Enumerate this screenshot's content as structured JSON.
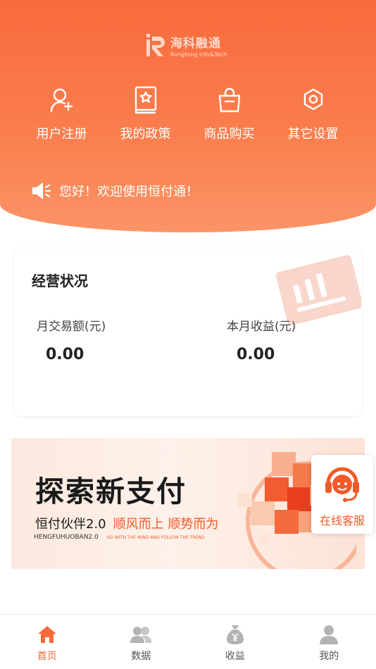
{
  "brand": {
    "name": "海科融通",
    "sub": "Rongtong Info&Tech"
  },
  "quick_actions": [
    {
      "label": "用户注册",
      "icon": "user-add-icon"
    },
    {
      "label": "我的政策",
      "icon": "policy-book-icon"
    },
    {
      "label": "商品购买",
      "icon": "shopping-bag-icon"
    },
    {
      "label": "其它设置",
      "icon": "settings-hex-icon"
    }
  ],
  "notice": {
    "icon": "speaker-icon",
    "text": "您好！欢迎使用恒付通！"
  },
  "business": {
    "title": "经营状况",
    "monthly_volume_label": "月交易额(元)",
    "monthly_volume_value": "0.00",
    "monthly_income_label": "本月收益(元)",
    "monthly_income_value": "0.00"
  },
  "banner": {
    "title": "探索新支付",
    "subtitle": "恒付伙伴2.0",
    "slogan": "顺风而上  顺势而为",
    "pinyin": "HENGFUHUOBAN2.0",
    "english": "GO WITH THE WIND AND FOLLOW THE TREND"
  },
  "service": {
    "label": "在线客服",
    "icon": "customer-service-icon"
  },
  "tabs": [
    {
      "label": "首页",
      "icon": "home-icon",
      "active": true
    },
    {
      "label": "数据",
      "icon": "users-data-icon",
      "active": false
    },
    {
      "label": "收益",
      "icon": "money-bag-icon",
      "active": false
    },
    {
      "label": "我的",
      "icon": "profile-icon",
      "active": false
    }
  ],
  "colors": {
    "primary": "#f86a3c",
    "accent": "#f05a28",
    "tab_inactive": "#b3b3b3"
  }
}
